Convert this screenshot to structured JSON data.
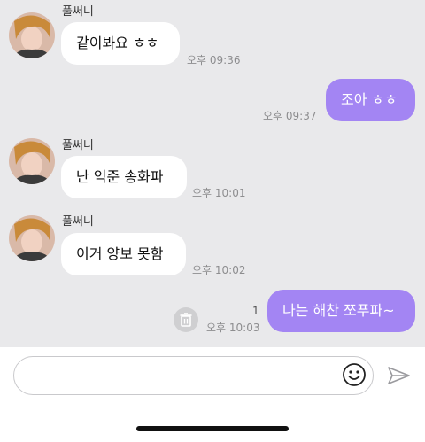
{
  "contact": {
    "name": "풀써니"
  },
  "messages": [
    {
      "direction": "in",
      "sender": "풀써니",
      "text": "같이봐요 ㅎㅎ",
      "time": "오후 09:36"
    },
    {
      "direction": "out",
      "text": "조아 ㅎㅎ",
      "time": "오후 09:37"
    },
    {
      "direction": "in",
      "sender": "풀써니",
      "text": "난 익준 송화파",
      "time": "오후 10:01"
    },
    {
      "direction": "in",
      "sender": "풀써니",
      "text": "이거 양보 못함",
      "time": "오후 10:02"
    },
    {
      "direction": "out",
      "text": "나는 해찬 쪼푸파~",
      "time": "오후 10:03",
      "unread_count": "1"
    }
  ],
  "composer": {
    "value": "",
    "placeholder": ""
  },
  "icons": {
    "avatar": "profile-photo",
    "delete": "trash-icon",
    "emoji": "smiley-icon",
    "send": "paper-plane-icon"
  },
  "colors": {
    "chat_background": "#e9e9eb",
    "incoming_bubble": "#ffffff",
    "outgoing_bubble": "#a385f3"
  }
}
